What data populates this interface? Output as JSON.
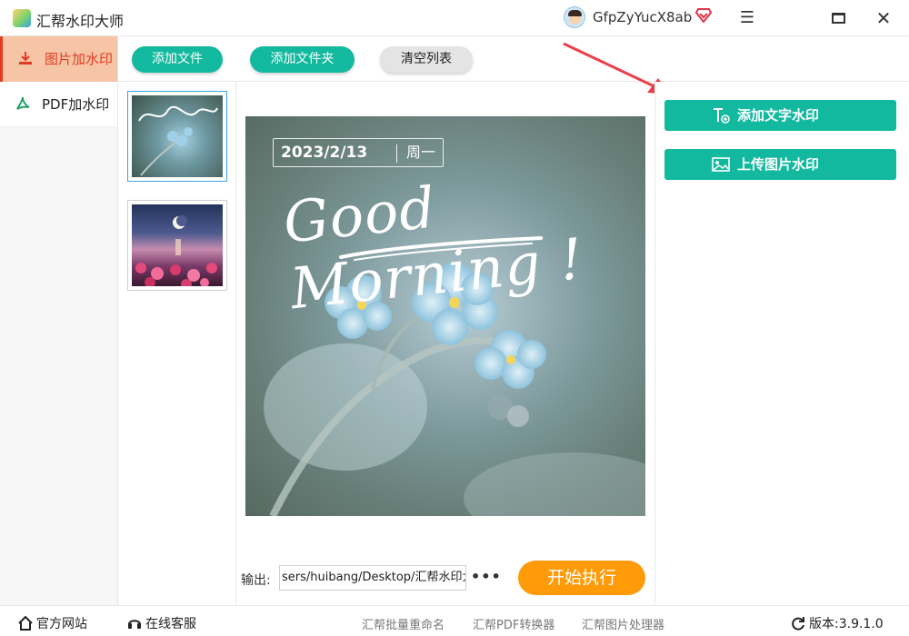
{
  "app": {
    "title": "汇帮水印大师",
    "username": "GfpZyYucX8ab"
  },
  "sidebar": {
    "items": [
      {
        "label": "图片加水印",
        "active": true
      },
      {
        "label": "PDF加水印",
        "active": false
      }
    ]
  },
  "toolbar": {
    "add_file": "添加文件",
    "add_folder": "添加文件夹",
    "clear_list": "清空列表"
  },
  "preview": {
    "date": "2023/2/13",
    "weekday": "周一",
    "greeting": "Good Morning !"
  },
  "output": {
    "label": "输出:",
    "path": "sers/huibang/Desktop/汇帮水印大师",
    "more": "•••"
  },
  "start_button": "开始执行",
  "right_panel": {
    "add_text_watermark": "添加文字水印",
    "upload_image_watermark": "上传图片水印"
  },
  "footer": {
    "official_site": "官方网站",
    "online_service": "在线客服",
    "links": [
      "汇帮批量重命名",
      "汇帮PDF转换器",
      "汇帮图片处理器"
    ],
    "version_label": "版本:",
    "version": "3.9.1.0"
  },
  "colors": {
    "accent": "#13b99f",
    "start": "#ff9a08",
    "sidebar_active_bg": "#f6c4a6",
    "sidebar_active_text": "#e23b22",
    "arrow": "#e8414d"
  },
  "icons": {
    "logo": "app-logo",
    "vip": "vip-diamond-icon",
    "image_watermark_side": "download-icon",
    "pdf_side": "pdf-icon",
    "text_watermark": "text-add-icon",
    "image_watermark": "image-icon",
    "home": "home-icon",
    "service": "headset-icon",
    "version": "refresh-icon"
  }
}
